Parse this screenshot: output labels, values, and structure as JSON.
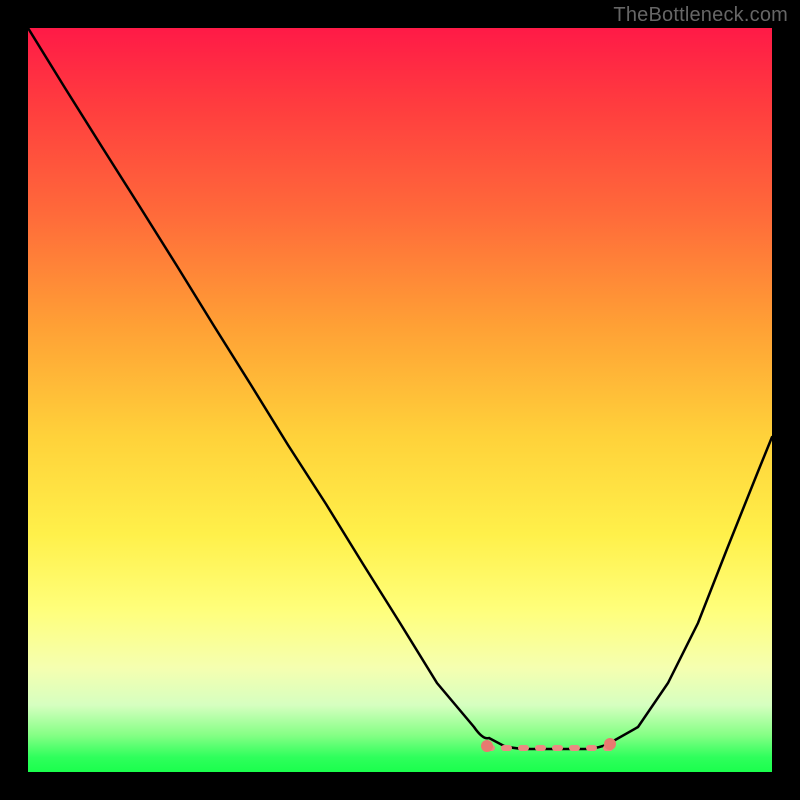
{
  "attribution": "TheBottleneck.com",
  "colors": {
    "curve": "#000000",
    "flat_segment": "#ea8b82",
    "endpoint_dot": "#e87a70",
    "frame_bg": "#000000",
    "gradient_top": "#ff1a47",
    "gradient_bottom": "#1aff4d"
  },
  "chart_data": {
    "type": "line",
    "title": "",
    "xlabel": "",
    "ylabel": "",
    "xlim": [
      0,
      100
    ],
    "ylim": [
      0,
      100
    ],
    "grid": false,
    "series": [
      {
        "name": "bottleneck-curve",
        "x": [
          0,
          5,
          10,
          15,
          20,
          25,
          30,
          35,
          40,
          45,
          50,
          55,
          60,
          62,
          64,
          67,
          72,
          75,
          78,
          82,
          86,
          90,
          94,
          98,
          100
        ],
        "values": [
          100,
          92,
          84,
          76,
          68,
          60,
          52,
          44,
          36,
          28,
          20,
          12,
          6,
          4.5,
          3.5,
          3,
          3,
          3,
          3.5,
          6,
          12,
          20,
          30,
          40,
          45
        ]
      }
    ],
    "annotations": [
      {
        "name": "flat-minimum-segment",
        "x_start": 62,
        "x_end": 78,
        "y": 3,
        "color": "#ea8b82"
      }
    ]
  }
}
